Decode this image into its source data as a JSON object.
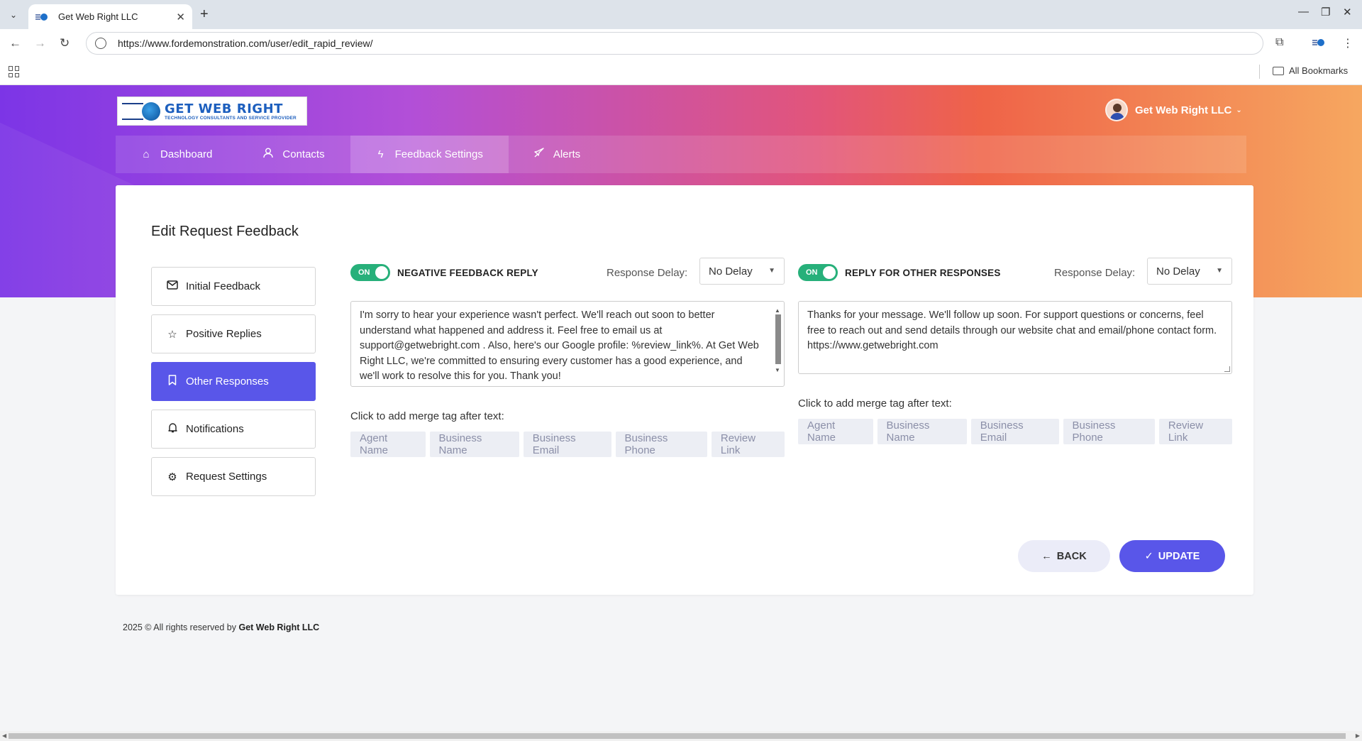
{
  "browser": {
    "tab_title": "Get Web Right LLC",
    "url": "https://www.fordemonstration.com/user/edit_rapid_review/",
    "all_bookmarks": "All Bookmarks"
  },
  "header": {
    "logo_name": "GET WEB RIGHT",
    "logo_tagline": "TECHNOLOGY CONSULTANTS AND SERVICE PROVIDER",
    "user_name": "Get Web Right LLC"
  },
  "nav": [
    {
      "label": "Dashboard",
      "icon": "home-icon"
    },
    {
      "label": "Contacts",
      "icon": "user-icon"
    },
    {
      "label": "Feedback Settings",
      "icon": "bolt-icon",
      "active": true
    },
    {
      "label": "Alerts",
      "icon": "rocket-icon"
    }
  ],
  "card": {
    "title": "Edit Request Feedback"
  },
  "sidebar": [
    {
      "label": "Initial Feedback",
      "icon": "mail-icon"
    },
    {
      "label": "Positive Replies",
      "icon": "star-icon"
    },
    {
      "label": "Other Responses",
      "icon": "bookmark-icon",
      "active": true
    },
    {
      "label": "Notifications",
      "icon": "bell-icon"
    },
    {
      "label": "Request Settings",
      "icon": "gear-icon"
    }
  ],
  "panels": {
    "negative": {
      "toggle": "ON",
      "label": "NEGATIVE FEEDBACK REPLY",
      "delay_label": "Response Delay:",
      "delay_value": "No Delay",
      "text": "I'm sorry to hear your experience wasn't perfect. We'll reach out soon to better understand what happened and address it. Feel free to email us at support@getwebright.com . Also, here's our Google profile: %review_link%. At Get Web Right LLC, we're committed to ensuring every customer has a good experience, and we'll work to resolve this for you. Thank you!",
      "merge_label": "Click to add merge tag after text:",
      "tags": [
        "Agent Name",
        "Business Name",
        "Business Email",
        "Business Phone",
        "Review Link"
      ]
    },
    "other": {
      "toggle": "ON",
      "label": "REPLY FOR OTHER RESPONSES",
      "delay_label": "Response Delay:",
      "delay_value": "No Delay",
      "text": "Thanks for your message. We'll follow up soon. For support questions or concerns, feel free to reach out and send details through our website chat and email/phone contact form. https://www.getwebright.com",
      "merge_label": "Click to add merge tag after text:",
      "tags": [
        "Agent Name",
        "Business Name",
        "Business Email",
        "Business Phone",
        "Review Link"
      ]
    }
  },
  "buttons": {
    "back": "BACK",
    "update": "UPDATE"
  },
  "footer": {
    "text": "2025 © All rights reserved by",
    "company": "Get Web Right LLC"
  },
  "colors": {
    "accent": "#5956e9",
    "toggle_on": "#27b07a"
  }
}
